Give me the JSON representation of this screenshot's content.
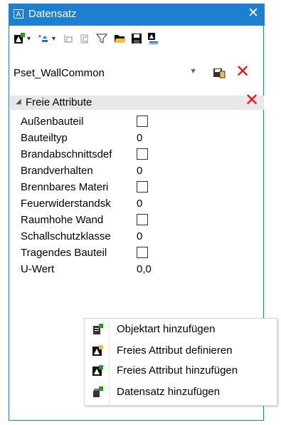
{
  "window": {
    "title": "Datensatz",
    "app_icon": "A",
    "close_glyph": "✕"
  },
  "toolbar": {
    "icons": [
      "new-attribute-icon",
      "add-attribute-icon",
      "copy-icon",
      "paste-icon",
      "filter-icon",
      "open-folder-icon",
      "save-icon",
      "assign-icon"
    ]
  },
  "dataset": {
    "selected": "Pset_WallCommon"
  },
  "group": {
    "label": "Freie Attribute"
  },
  "attributes": [
    {
      "name": "Außenbauteil",
      "kind": "checkbox",
      "value": ""
    },
    {
      "name": "Bauteiltyp",
      "kind": "text",
      "value": "0"
    },
    {
      "name": "Brandabschnittsdef",
      "kind": "checkbox",
      "value": ""
    },
    {
      "name": "Brandverhalten",
      "kind": "text",
      "value": "0"
    },
    {
      "name": "Brennbares Materi",
      "kind": "checkbox",
      "value": ""
    },
    {
      "name": "Feuerwiderstandsk",
      "kind": "text",
      "value": "0"
    },
    {
      "name": "Raumhohe Wand",
      "kind": "checkbox",
      "value": ""
    },
    {
      "name": "Schallschutzklasse",
      "kind": "text",
      "value": "0"
    },
    {
      "name": "Tragendes Bauteil",
      "kind": "checkbox",
      "value": ""
    },
    {
      "name": "U-Wert",
      "kind": "text",
      "value": "0,0"
    }
  ],
  "context_menu": {
    "items": [
      {
        "label": "Objektart hinzufügen",
        "icon": "object-type-icon"
      },
      {
        "label": "Freies Attribut definieren",
        "icon": "define-attribute-icon"
      },
      {
        "label": "Freies Attribut hinzufügen",
        "icon": "add-attribute-icon"
      },
      {
        "label": "Datensatz hinzufügen",
        "icon": "add-dataset-icon"
      }
    ]
  },
  "colors": {
    "title_bar": "#1e7fd0",
    "delete": "#e11111"
  }
}
